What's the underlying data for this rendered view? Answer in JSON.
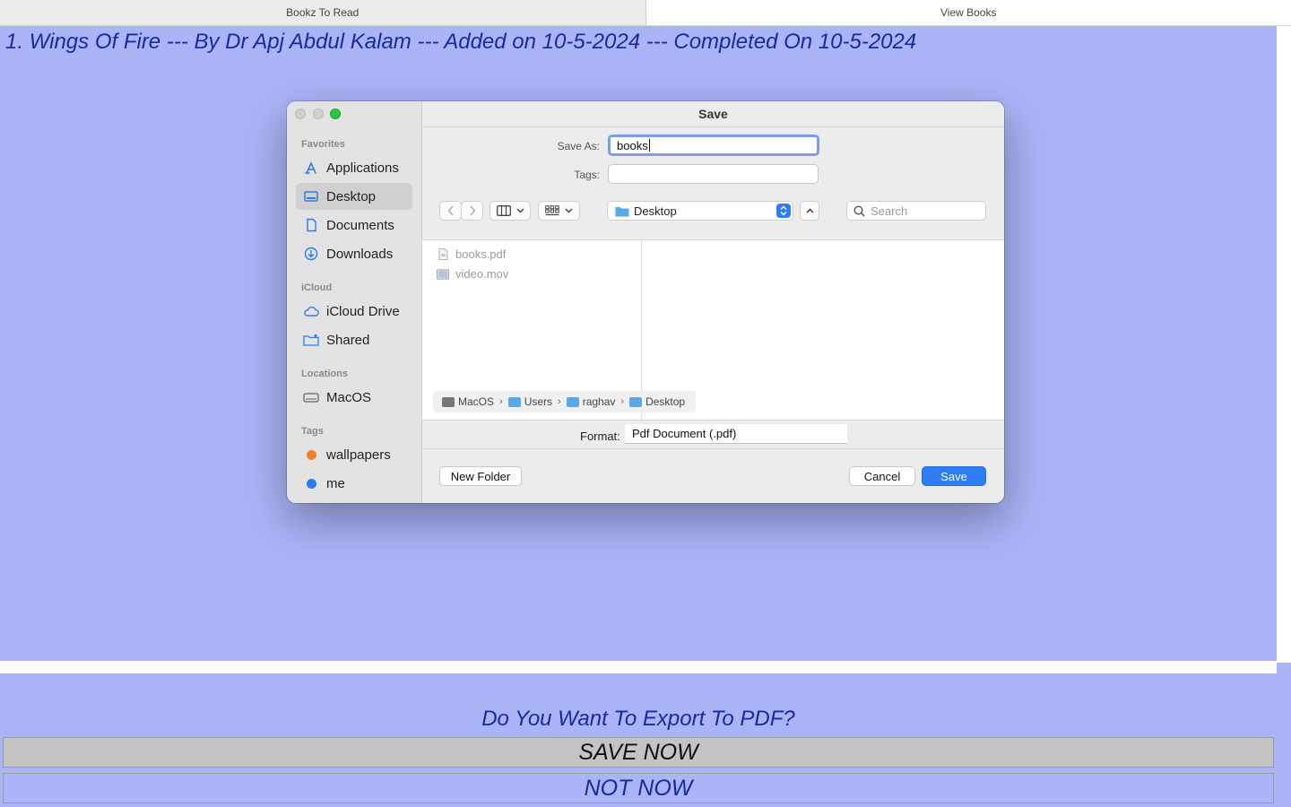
{
  "tabs": [
    {
      "label": "Bookz To Read",
      "active": true
    },
    {
      "label": "View Books",
      "active": false
    }
  ],
  "books": [
    {
      "text": "1. Wings Of Fire --- By Dr Apj Abdul Kalam --- Added on 10-5-2024 --- Completed On 10-5-2024"
    }
  ],
  "export": {
    "question": "Do You Want To Export To PDF?",
    "save_now_label": "SAVE NOW",
    "not_now_label": "NOT NOW"
  },
  "dialog": {
    "title": "Save",
    "save_as_label": "Save As:",
    "save_as_value": "books",
    "tags_label": "Tags:",
    "tags_value": "",
    "location": "Desktop",
    "search_placeholder": "Search",
    "sidebar": {
      "favorites_header": "Favorites",
      "favorites": [
        {
          "label": "Applications",
          "icon": "applications-icon"
        },
        {
          "label": "Desktop",
          "icon": "desktop-icon",
          "selected": true
        },
        {
          "label": "Documents",
          "icon": "document-icon"
        },
        {
          "label": "Downloads",
          "icon": "downloads-icon"
        }
      ],
      "icloud_header": "iCloud",
      "icloud": [
        {
          "label": "iCloud Drive",
          "icon": "cloud-icon"
        },
        {
          "label": "Shared",
          "icon": "shared-folder-icon"
        }
      ],
      "locations_header": "Locations",
      "locations": [
        {
          "label": "MacOS",
          "icon": "drive-icon"
        }
      ],
      "tags_header": "Tags",
      "tags": [
        {
          "label": "wallpapers",
          "color": "#f0812a"
        },
        {
          "label": "me",
          "color": "#2a7cf0"
        }
      ]
    },
    "files": [
      {
        "name": "books.pdf",
        "icon": "pdf-file-icon"
      },
      {
        "name": "video.mov",
        "icon": "video-file-icon"
      }
    ],
    "path": [
      "MacOS",
      "Users",
      "raghav",
      "Desktop"
    ],
    "format_label": "Format:",
    "format_value": "Pdf Document (.pdf)",
    "new_folder_label": "New Folder",
    "cancel_label": "Cancel",
    "save_label": "Save"
  },
  "colors": {
    "background": "#aab4f7",
    "text_accent": "#1a2a9e",
    "primary_button": "#2e7cf6"
  }
}
